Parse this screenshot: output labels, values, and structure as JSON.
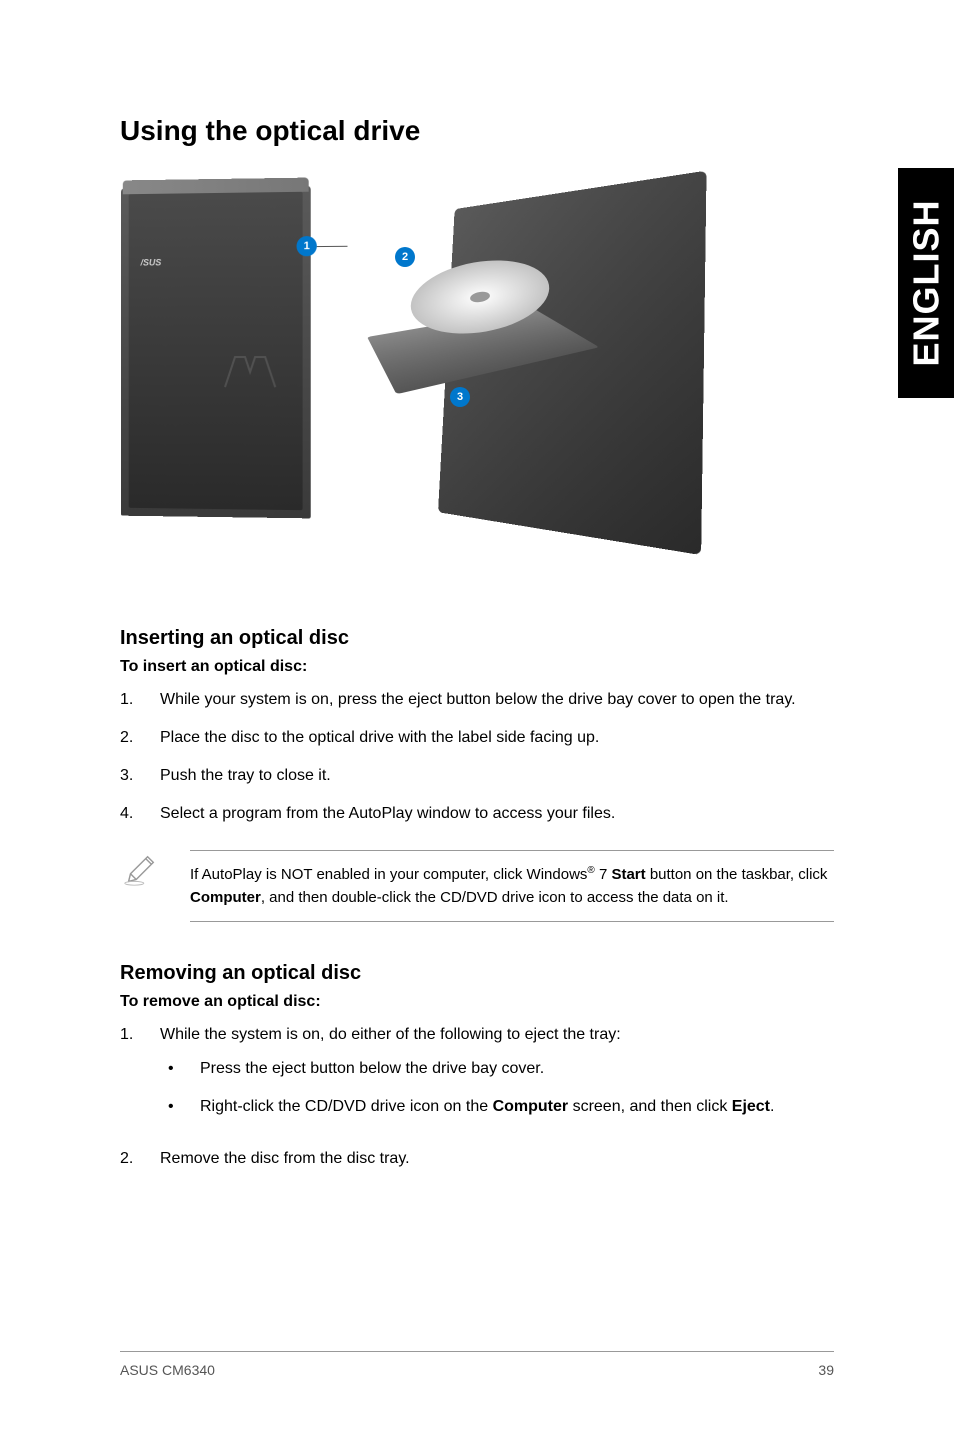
{
  "sideTab": "ENGLISH",
  "title": "Using the optical drive",
  "callouts": {
    "c1": "1",
    "c2": "2",
    "c3": "3"
  },
  "section1": {
    "heading": "Inserting an optical disc",
    "subheading": "To insert an optical disc:",
    "items": [
      {
        "num": "1.",
        "text": "While your system is on, press the eject button below the drive bay cover to open the tray."
      },
      {
        "num": "2.",
        "text": "Place the disc to the optical drive with the label side facing up."
      },
      {
        "num": "3.",
        "text": "Push the tray to close it."
      },
      {
        "num": "4.",
        "text": "Select a program from the AutoPlay window to access your files."
      }
    ]
  },
  "note": {
    "prefix": "If AutoPlay is NOT enabled in your computer, click Windows",
    "reg": "®",
    "mid1": " 7 ",
    "start": "Start",
    "mid2": " button on the taskbar, click ",
    "computer": "Computer",
    "suffix": ", and then double-click the CD/DVD drive icon to access the data on it."
  },
  "section2": {
    "heading": "Removing an optical disc",
    "subheading": "To remove an optical disc:",
    "item1": {
      "num": "1.",
      "text": "While the system is on, do either of the following to eject the tray:"
    },
    "bullets": [
      {
        "text": "Press the eject button below the drive bay cover."
      },
      {
        "prefix": "Right-click the CD/DVD drive icon on the ",
        "bold1": "Computer",
        "mid": " screen, and then click ",
        "bold2": "Eject",
        "suffix": "."
      }
    ],
    "item2": {
      "num": "2.",
      "text": "Remove the disc from the disc tray."
    }
  },
  "footer": {
    "left": "ASUS CM6340",
    "right": "39"
  }
}
